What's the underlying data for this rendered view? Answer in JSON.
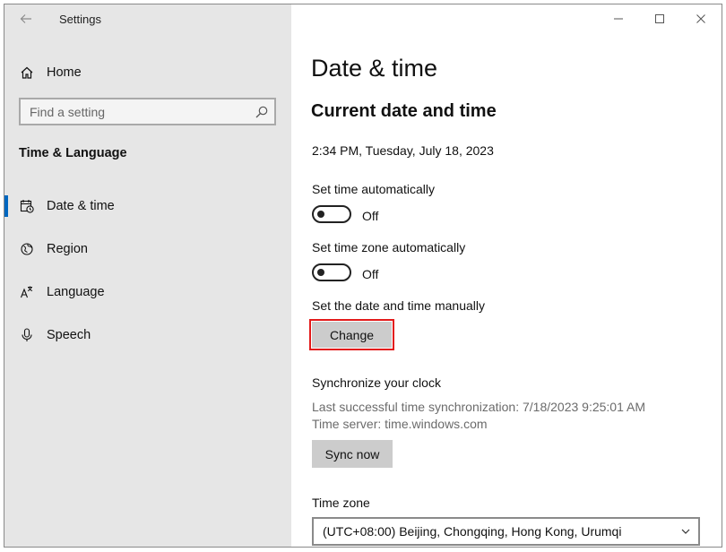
{
  "window": {
    "title": "Settings",
    "controls": [
      "minimize",
      "maximize",
      "close"
    ]
  },
  "sidebar": {
    "home_label": "Home",
    "search": {
      "placeholder": "Find a setting",
      "value": ""
    },
    "section_header": "Time & Language",
    "items": [
      {
        "label": "Date & time",
        "icon": "calendar-clock-icon",
        "selected": true
      },
      {
        "label": "Region",
        "icon": "globe-icon",
        "selected": false
      },
      {
        "label": "Language",
        "icon": "language-icon",
        "selected": false
      },
      {
        "label": "Speech",
        "icon": "microphone-icon",
        "selected": false
      }
    ]
  },
  "main": {
    "page_title": "Date & time",
    "sub_title": "Current date and time",
    "current_datetime": "2:34 PM, Tuesday, July 18, 2023",
    "set_time_auto": {
      "label": "Set time automatically",
      "state": "Off"
    },
    "set_tz_auto": {
      "label": "Set time zone automatically",
      "state": "Off"
    },
    "manual": {
      "label": "Set the date and time manually",
      "button": "Change"
    },
    "sync": {
      "title": "Synchronize your clock",
      "last_sync": "Last successful time synchronization: 7/18/2023 9:25:01 AM",
      "server": "Time server: time.windows.com",
      "button": "Sync now"
    },
    "timezone": {
      "label": "Time zone",
      "value": "(UTC+08:00) Beijing, Chongqing, Hong Kong, Urumqi"
    }
  },
  "colors": {
    "accent": "#0067c0",
    "highlight_border": "#e31b1b",
    "sidebar_bg": "#e6e6e6",
    "button_bg": "#cccccc"
  }
}
